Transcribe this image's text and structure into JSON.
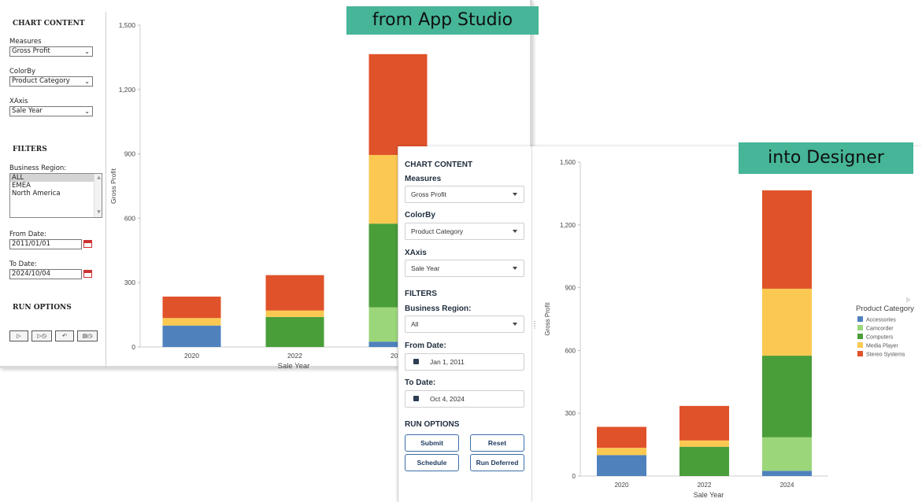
{
  "tags": {
    "studio": "from App Studio",
    "designer": "into Designer"
  },
  "studio": {
    "chart_content_title": "CHART CONTENT",
    "measures_label": "Measures",
    "measures_value": "Gross Profit",
    "colorby_label": "ColorBy",
    "colorby_value": "Product Category",
    "xaxis_label": "XAxis",
    "xaxis_value": "Sale Year",
    "filters_title": "FILTERS",
    "business_region_label": "Business Region:",
    "region_options": [
      "ALL",
      "EMEA",
      "North America"
    ],
    "from_date_label": "From Date:",
    "from_date_value": "2011/01/01",
    "to_date_label": "To Date:",
    "to_date_value": "2024/10/04",
    "run_options_title": "RUN OPTIONS"
  },
  "designer": {
    "chart_content_title": "CHART CONTENT",
    "measures_label": "Measures",
    "measures_value": "Gross Profit",
    "colorby_label": "ColorBy",
    "colorby_value": "Product Category",
    "xaxis_label": "XAxis",
    "xaxis_value": "Sale Year",
    "filters_title": "FILTERS",
    "business_region_label": "Business Region:",
    "business_region_value": "All",
    "from_date_label": "From Date:",
    "from_date_value": "Jan 1, 2011",
    "to_date_label": "To Date:",
    "to_date_value": "Oct 4, 2024",
    "run_options_title": "RUN OPTIONS",
    "buttons": {
      "submit": "Submit",
      "reset": "Reset",
      "schedule": "Schedule",
      "run_deferred": "Run Deferred"
    },
    "legend_title": "Product Category"
  },
  "colors": {
    "Accessories": "#4f81bd",
    "Camcorder": "#9bd77a",
    "Computers": "#4a9e3a",
    "Media Player": "#fbc952",
    "Stereo Systems": "#e0522a"
  },
  "chart_data": [
    {
      "type": "bar",
      "stacked": true,
      "xlabel": "Sale Year",
      "ylabel": "Gross Profit",
      "ylim": [
        0,
        1500
      ],
      "yticks": [
        0,
        300,
        600,
        900,
        1200,
        1500
      ],
      "ytick_labels": [
        "0",
        "300",
        "600",
        "900",
        "1,200",
        "1,500"
      ],
      "categories": [
        "2020",
        "2022",
        "2024"
      ],
      "series": [
        {
          "name": "Accessories",
          "values": [
            100,
            0,
            25
          ]
        },
        {
          "name": "Camcorder",
          "values": [
            0,
            0,
            160
          ]
        },
        {
          "name": "Computers",
          "values": [
            0,
            140,
            390
          ]
        },
        {
          "name": "Media Player",
          "values": [
            35,
            30,
            320
          ]
        },
        {
          "name": "Stereo Systems",
          "values": [
            100,
            165,
            470
          ]
        }
      ]
    },
    {
      "type": "bar",
      "stacked": true,
      "xlabel": "Sale Year",
      "ylabel": "Gross Profit",
      "ylim": [
        0,
        1500
      ],
      "yticks": [
        0,
        300,
        600,
        900,
        1200,
        1500
      ],
      "ytick_labels": [
        "0",
        "300",
        "600",
        "900",
        "1,200",
        "1,500"
      ],
      "categories": [
        "2020",
        "2022",
        "2024"
      ],
      "legend": "right",
      "series": [
        {
          "name": "Accessories",
          "values": [
            100,
            0,
            25
          ]
        },
        {
          "name": "Camcorder",
          "values": [
            0,
            0,
            160
          ]
        },
        {
          "name": "Computers",
          "values": [
            0,
            140,
            390
          ]
        },
        {
          "name": "Media Player",
          "values": [
            35,
            30,
            320
          ]
        },
        {
          "name": "Stereo Systems",
          "values": [
            100,
            165,
            470
          ]
        }
      ]
    }
  ]
}
